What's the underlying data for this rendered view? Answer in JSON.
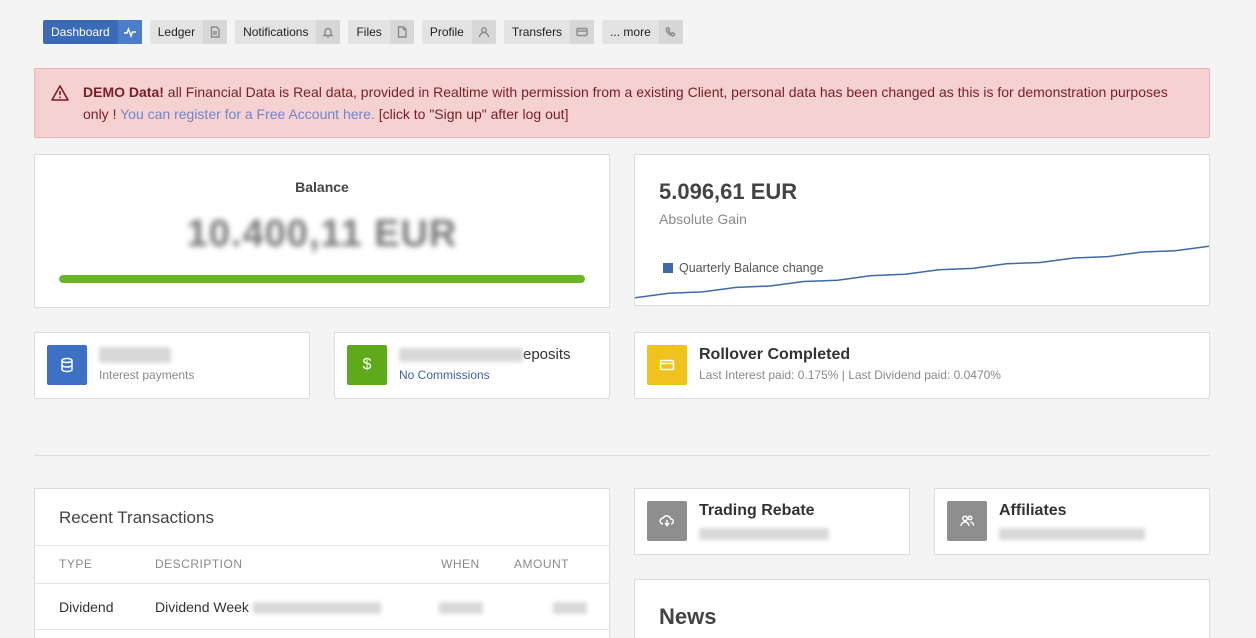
{
  "nav": {
    "items": [
      {
        "label": "Dashboard"
      },
      {
        "label": "Ledger"
      },
      {
        "label": "Notifications"
      },
      {
        "label": "Files"
      },
      {
        "label": "Profile"
      },
      {
        "label": "Transfers"
      },
      {
        "label": "... more"
      }
    ]
  },
  "alert": {
    "bold": "DEMO Data!",
    "text": " all Financial Data is Real data, provided in Realtime with permission from a existing Client, personal data has been changed as this is for demonstration purposes only ! ",
    "link": "You can register for a Free Account here.",
    "suffix": " [click to \"Sign up\" after log out]"
  },
  "balance": {
    "title": "Balance",
    "amount": "10.400,11 EUR",
    "progress_fraction": 1.0,
    "progress_color": "#6cb528"
  },
  "gain": {
    "value": "5.096,61 EUR",
    "label": "Absolute Gain",
    "legend": "Quarterly Balance change",
    "line_color": "#3f6aa6"
  },
  "chart_data": {
    "type": "line",
    "series": [
      {
        "name": "Quarterly Balance change",
        "values": [
          0,
          1,
          2,
          3,
          4,
          5,
          6,
          7,
          8,
          9,
          10,
          11,
          12,
          13,
          14,
          15,
          16,
          17
        ]
      }
    ]
  },
  "info": {
    "interest": {
      "main_suffix": "",
      "small": "Interest payments",
      "color": "#3d71c4"
    },
    "deposits": {
      "main_suffix": "eposits",
      "small": "No Commissions",
      "color": "#5faa1b"
    },
    "rollover": {
      "main": "Rollover Completed",
      "small": "Last Interest paid: 0.175% | Last Dividend paid: 0.0470%",
      "color": "#efc21d"
    },
    "rebate": {
      "main": "Trading Rebate",
      "color": "#8e8e8e"
    },
    "affiliates": {
      "main": "Affiliates",
      "color": "#8e8e8e"
    }
  },
  "transactions": {
    "title": "Recent Transactions",
    "columns": [
      "TYPE",
      "DESCRIPTION",
      "WHEN",
      "AMOUNT"
    ],
    "rows": [
      {
        "type": "Dividend",
        "description": "Dividend Week"
      }
    ]
  },
  "news": {
    "title": "News"
  }
}
